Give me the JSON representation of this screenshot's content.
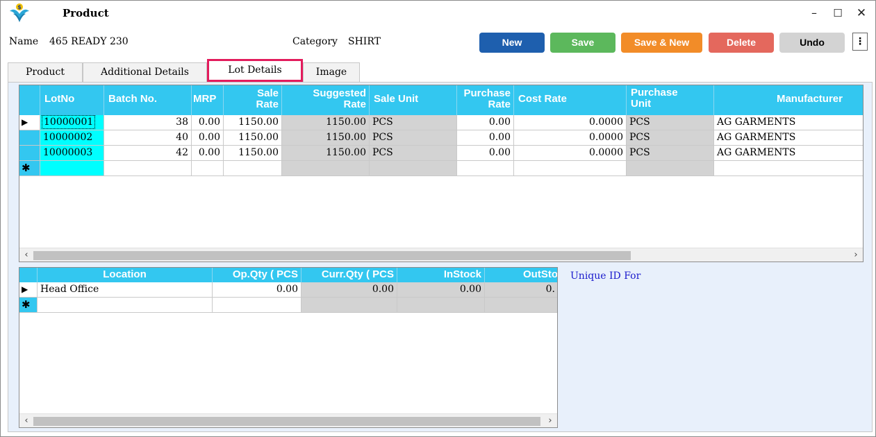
{
  "window": {
    "title": "Product",
    "minimize_glyph": "–",
    "maximize_glyph": "☐",
    "close_glyph": "✕",
    "logo_icon": "product-logo-icon"
  },
  "header": {
    "name_label": "Name",
    "name_value": "465 READY 230",
    "category_label": "Category",
    "category_value": "SHIRT"
  },
  "toolbar": {
    "new_label": "New",
    "save_label": "Save",
    "save_new_label": "Save & New",
    "delete_label": "Delete",
    "undo_label": "Undo",
    "more_glyph": "⋮",
    "colors": {
      "new": "#1e5fae",
      "save": "#5cb85c",
      "save_new": "#f28c28",
      "delete": "#e4685d",
      "undo": "#d3d3d3"
    }
  },
  "tabs": [
    {
      "label": "Product",
      "active": false
    },
    {
      "label": "Additional Details",
      "active": false
    },
    {
      "label": "Lot Details",
      "active": true
    },
    {
      "label": "Image",
      "active": false
    }
  ],
  "lot_grid": {
    "headers": {
      "lot_no": "LotNo",
      "batch_no": "Batch No.",
      "mrp": "MRP",
      "sale_rate_1": "Sale",
      "sale_rate_2": "Rate",
      "suggested_rate_1": "Suggested",
      "suggested_rate_2": "Rate",
      "sale_unit": "Sale Unit",
      "purchase_rate_1": "Purchase",
      "purchase_rate_2": "Rate",
      "cost_rate": "Cost Rate",
      "purchase_unit_1": "Purchase",
      "purchase_unit_2": "Unit",
      "manufacturer": "Manufacturer"
    },
    "rows": [
      {
        "lot_no": "10000001",
        "batch_no": "38",
        "mrp": "0.00",
        "sale_rate": "1150.00",
        "suggested_rate": "1150.00",
        "sale_unit": "PCS",
        "purchase_rate": "0.00",
        "cost_rate": "0.0000",
        "purchase_unit": "PCS",
        "manufacturer": "AG GARMENTS"
      },
      {
        "lot_no": "10000002",
        "batch_no": "40",
        "mrp": "0.00",
        "sale_rate": "1150.00",
        "suggested_rate": "1150.00",
        "sale_unit": "PCS",
        "purchase_rate": "0.00",
        "cost_rate": "0.0000",
        "purchase_unit": "PCS",
        "manufacturer": "AG GARMENTS"
      },
      {
        "lot_no": "10000003",
        "batch_no": "42",
        "mrp": "0.00",
        "sale_rate": "1150.00",
        "suggested_rate": "1150.00",
        "sale_unit": "PCS",
        "purchase_rate": "0.00",
        "cost_rate": "0.0000",
        "purchase_unit": "PCS",
        "manufacturer": "AG GARMENTS"
      }
    ],
    "current_row_glyph": "▶",
    "new_row_glyph": "✱"
  },
  "location_grid": {
    "headers": {
      "location": "Location",
      "op_qty": "Op.Qty ( PCS",
      "curr_qty": "Curr.Qty ( PCS",
      "in_stock": "InStock",
      "out_stock": "OutSto"
    },
    "rows": [
      {
        "location": "Head Office",
        "op_qty": "0.00",
        "curr_qty": "0.00",
        "in_stock": "0.00",
        "out_stock": "0."
      }
    ]
  },
  "unique_id_label": "Unique ID For",
  "scroll": {
    "left_glyph": "‹",
    "right_glyph": "›"
  },
  "colors": {
    "grid_header": "#33c7f0",
    "selected_cell": "#00ffff",
    "readonly_cell": "#d3d3d3",
    "active_tab_border": "#e31b5c"
  }
}
